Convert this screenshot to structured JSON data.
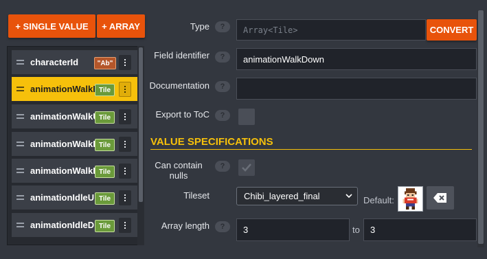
{
  "toolbar": {
    "add_single_label": "+ SINGLE VALUE",
    "add_array_label": "+ ARRAY"
  },
  "fields": [
    {
      "name": "characterId",
      "badge": "\"Ab\"",
      "badge_type": "string",
      "selected": false
    },
    {
      "name": "animationWalkD",
      "badge": "Tile",
      "badge_type": "tile",
      "selected": true
    },
    {
      "name": "animationWalkU",
      "badge": "Tile",
      "badge_type": "tile",
      "selected": false
    },
    {
      "name": "animationWalkL",
      "badge": "Tile",
      "badge_type": "tile",
      "selected": false
    },
    {
      "name": "animationWalkR",
      "badge": "Tile",
      "badge_type": "tile",
      "selected": false
    },
    {
      "name": "animationIdleU",
      "badge": "Tile",
      "badge_type": "tile",
      "selected": false
    },
    {
      "name": "animationIdleD",
      "badge": "Tile",
      "badge_type": "tile",
      "selected": false
    }
  ],
  "form": {
    "type_label": "Type",
    "type_value": "Array<Tile>",
    "convert_label": "CONVERT",
    "identifier_label": "Field identifier",
    "identifier_value": "animationWalkDown",
    "documentation_label": "Documentation",
    "documentation_value": "",
    "export_label": "Export to ToC",
    "export_checked": false,
    "section_title": "VALUE SPECIFICATIONS",
    "nulls_label_line1": "Can contain",
    "nulls_label_line2": "nulls",
    "nulls_checked": true,
    "tileset_label": "Tileset",
    "tileset_value": "Chibi_layered_final",
    "default_label": "Default:",
    "array_length_label": "Array length",
    "array_min": "3",
    "to_label": "to",
    "array_max": "3",
    "help_glyph": "?"
  },
  "icons": {
    "help": "help-icon",
    "drag": "drag-handle-icon",
    "menu": "kebab-menu-icon",
    "chevron": "chevron-down-icon",
    "delete": "backspace-icon",
    "check": "checkmark-icon"
  },
  "colors": {
    "background": "#33373f",
    "accent_orange": "#e8530b",
    "selection_yellow": "#f6c00b",
    "tile_badge": "#6a9a3a",
    "string_badge": "#b4562a"
  }
}
